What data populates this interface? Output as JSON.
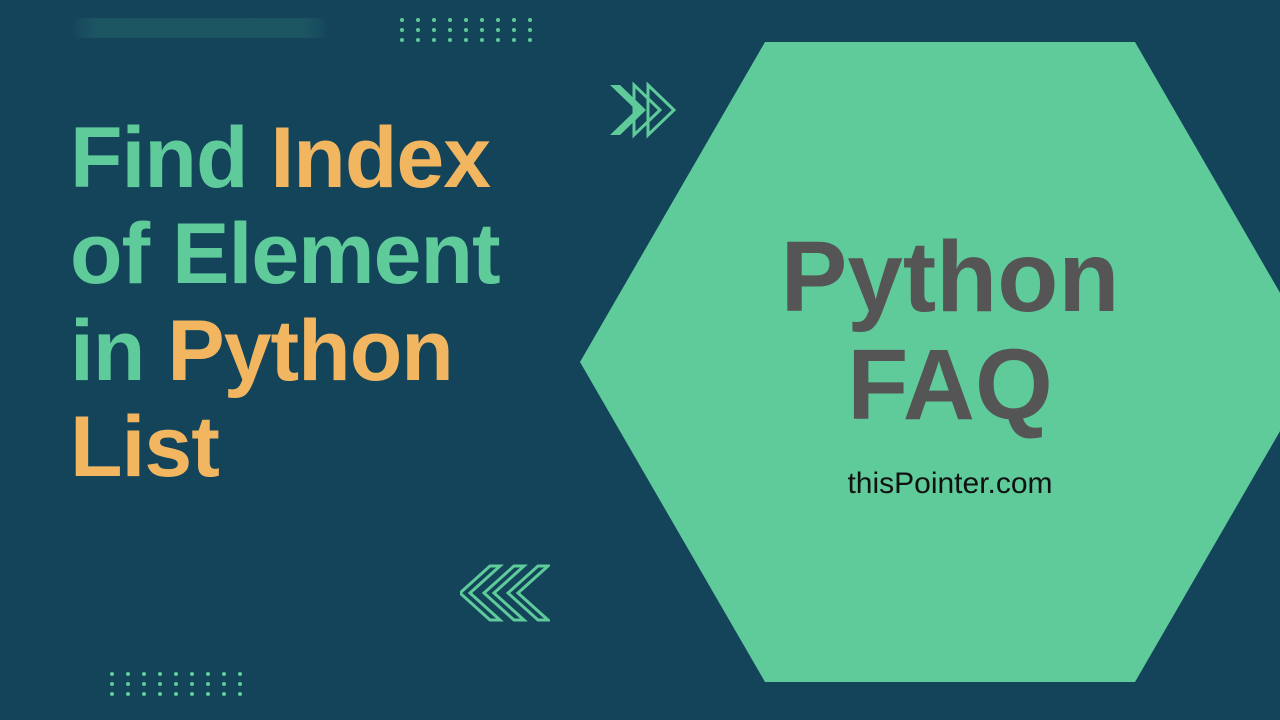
{
  "heading": {
    "w1": "Find",
    "w2": "Index",
    "w3": "of",
    "w4": "Element in",
    "w5": "Python List"
  },
  "hex": {
    "title_line1": "Python",
    "title_line2": "FAQ",
    "subtitle": "thisPointer.com"
  },
  "colors": {
    "bg": "#13445a",
    "green": "#5fca9a",
    "amber": "#f2b661",
    "hex_text": "#555555"
  }
}
